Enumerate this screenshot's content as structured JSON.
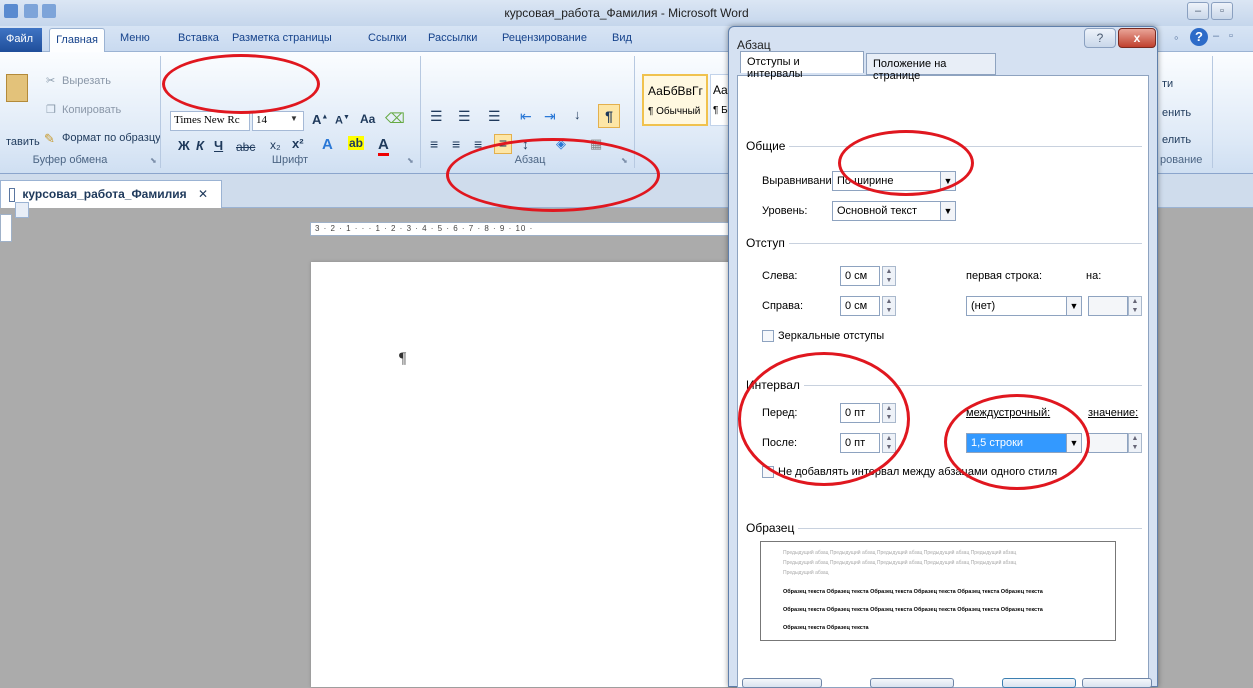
{
  "window": {
    "title": "курсовая_работа_Фамилия - Microsoft Word"
  },
  "tabs": {
    "file": "Файл",
    "home": "Главная",
    "items": [
      "Меню",
      "Вставка",
      "Разметка страницы",
      "Ссылки",
      "Рассылки",
      "Рецензирование",
      "Вид"
    ]
  },
  "clipboard": {
    "paste": "тавить",
    "cut": "Вырезать",
    "copy": "Копировать",
    "format_painter": "Формат по образцу",
    "label": "Буфер обмена"
  },
  "font": {
    "name": "Times New Rc",
    "size": "14",
    "label": "Шрифт",
    "bold": "Ж",
    "italic": "К",
    "underline": "Ч",
    "case": "Aa"
  },
  "paragraph": {
    "label": "Абзац",
    "pilcrow": "¶"
  },
  "styles": {
    "normal_preview": "АаБбВвГг",
    "normal": "¶ Обычный",
    "no_spacing_preview": "Aal",
    "no_spacing": "¶ Бе"
  },
  "editing": {
    "find": "ти",
    "replace": "енить",
    "select": "елить",
    "label": "рование"
  },
  "document": {
    "tab_name": "курсовая_работа_Фамилия",
    "ruler": "3 · 2 · 1 · · · 1 · 2 · 3 · 4 · 5 · 6 · 7 · 8 · 9 · 10 ·"
  },
  "dialog": {
    "title": "Абзац",
    "help": "?",
    "close": "x",
    "tab_indents": "Отступы и интервалы",
    "tab_position": "Положение на странице",
    "general": {
      "section": "Общие",
      "alignment_label": "Выравнивание:",
      "alignment_value": "По ширине",
      "level_label": "Уровень:",
      "level_value": "Основной текст"
    },
    "indent": {
      "section": "Отступ",
      "left_label": "Слева:",
      "left_value": "0 см",
      "right_label": "Справа:",
      "right_value": "0 см",
      "first_line_label": "первая строка:",
      "first_line_value": "(нет)",
      "by_label": "на:",
      "mirror": "Зеркальные отступы"
    },
    "spacing": {
      "section": "Интервал",
      "before_label": "Перед:",
      "before_value": "0 пт",
      "after_label": "После:",
      "after_value": "0 пт",
      "line_label": "междустрочный:",
      "line_value": "1,5 строки",
      "value_label": "значение:",
      "no_space": "Не добавлять интервал между абзацами одного стиля"
    },
    "preview": {
      "section": "Образец",
      "prev_para": [
        "Предыдущий абзац Предыдущий абзац Предыдущий абзац Предыдущий абзац Предыдущий абзац",
        "Предыдущий абзац Предыдущий абзац Предыдущий абзац Предыдущий абзац Предыдущий абзац",
        "Предыдущий абзац"
      ],
      "sample": [
        "Образец текста Образец текста Образец текста Образец текста Образец текста Образец текста",
        "Образец текста Образец текста Образец текста Образец текста Образец текста Образец текста",
        "Образец текста Образец текста"
      ]
    }
  },
  "colors": {
    "annotation": "#e0171f",
    "selection": "#3399ff",
    "ribbon_accent": "#15428b"
  }
}
